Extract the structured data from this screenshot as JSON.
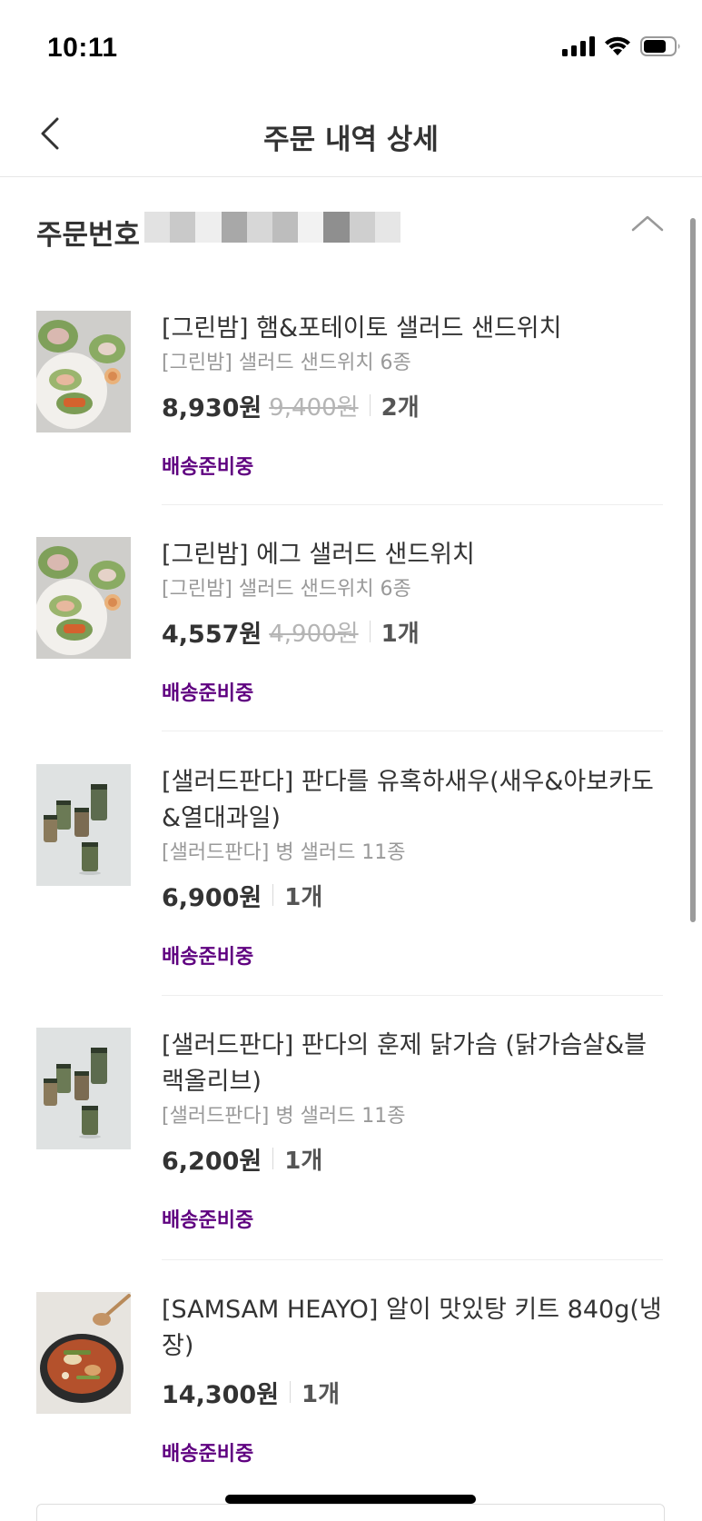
{
  "status_bar": {
    "time": "10:11"
  },
  "nav": {
    "title": "주문 내역 상세"
  },
  "order": {
    "label": "주문번호"
  },
  "products": [
    {
      "name": "[그린밤] 햄&포테이토 샐러드 샌드위치",
      "option": "[그린밤] 샐러드 샌드위치 6종",
      "price": "8,930원",
      "original_price": "9,400원",
      "quantity": "2개",
      "status": "배송준비중",
      "thumbnail": "sandwich-image"
    },
    {
      "name": "[그린밤] 에그 샐러드 샌드위치",
      "option": "[그린밤] 샐러드 샌드위치 6종",
      "price": "4,557원",
      "original_price": "4,900원",
      "quantity": "1개",
      "status": "배송준비중",
      "thumbnail": "sandwich-image"
    },
    {
      "name": "[샐러드판다] 판다를 유혹하새우(새우&아보카도&열대과일)",
      "option": "[샐러드판다] 병 샐러드 11종",
      "price": "6,900원",
      "original_price": "",
      "quantity": "1개",
      "status": "배송준비중",
      "thumbnail": "jar-salad-image"
    },
    {
      "name": "[샐러드판다] 판다의 훈제 닭가슴 (닭가슴살&블랙올리브)",
      "option": "[샐러드판다] 병 샐러드 11종",
      "price": "6,200원",
      "original_price": "",
      "quantity": "1개",
      "status": "배송준비중",
      "thumbnail": "jar-salad-image"
    },
    {
      "name": "[SAMSAM HEAYO] 알이 맛있탕 키트 840g(냉장)",
      "option": "",
      "price": "14,300원",
      "original_price": "",
      "quantity": "1개",
      "status": "배송준비중",
      "thumbnail": "stew-image"
    }
  ],
  "colors": {
    "accent": "#5f0080",
    "text": "#333333",
    "muted": "#999999",
    "divider": "#eeeeee"
  }
}
